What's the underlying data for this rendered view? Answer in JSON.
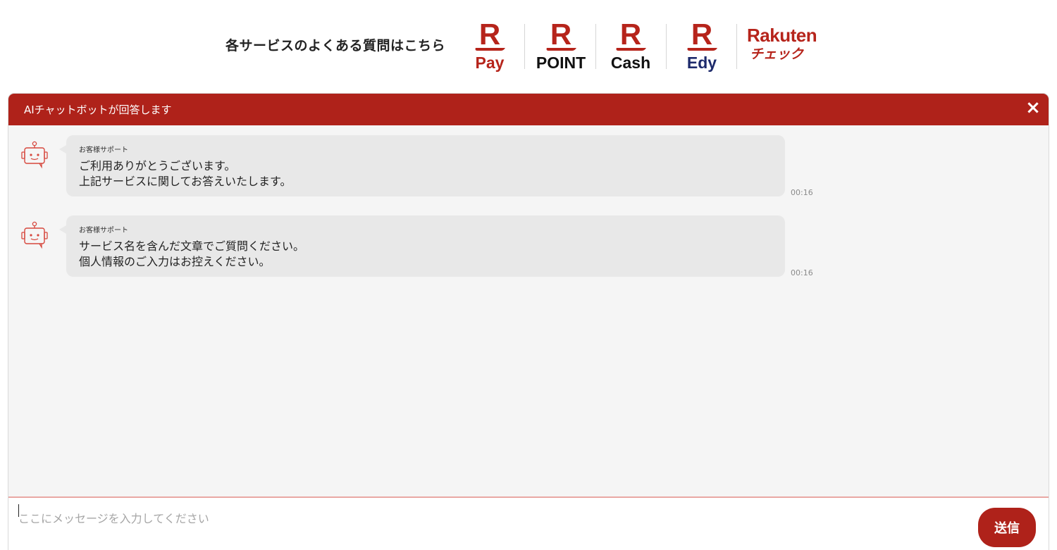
{
  "top_bar": {
    "faq_label": "各サービスのよくある質問はこちら",
    "services": {
      "pay": {
        "mark": "R",
        "name": "Pay"
      },
      "point": {
        "mark": "R",
        "name": "POINT"
      },
      "cash": {
        "mark": "R",
        "name": "Cash"
      },
      "edy": {
        "mark": "R",
        "name": "Edy"
      },
      "check": {
        "top": "Rakuten",
        "bottom": "チェック"
      }
    }
  },
  "chat": {
    "title": "AIチャットボットが回答します",
    "close_icon": "×",
    "messages": [
      {
        "sender": "お客様サポート",
        "lines": [
          "ご利用ありがとうございます。",
          "上記サービスに関してお答えいたします。"
        ],
        "time": "00:16"
      },
      {
        "sender": "お客様サポート",
        "lines": [
          "サービス名を含んだ文章でご質問ください。",
          "個人情報のご入力はお控えください。"
        ],
        "time": "00:16"
      }
    ],
    "input": {
      "placeholder": "ここにメッセージを入力してください",
      "value": ""
    },
    "send_label": "送信"
  },
  "colors": {
    "brand_red": "#af221a",
    "header_bg": "#af221a",
    "bubble_bg": "#e8e8e8",
    "chat_bg": "#f5f5f5",
    "edy_navy": "#1d2a6b"
  },
  "icons": {
    "bot_avatar": "robot-chat-icon",
    "close": "close-icon"
  }
}
